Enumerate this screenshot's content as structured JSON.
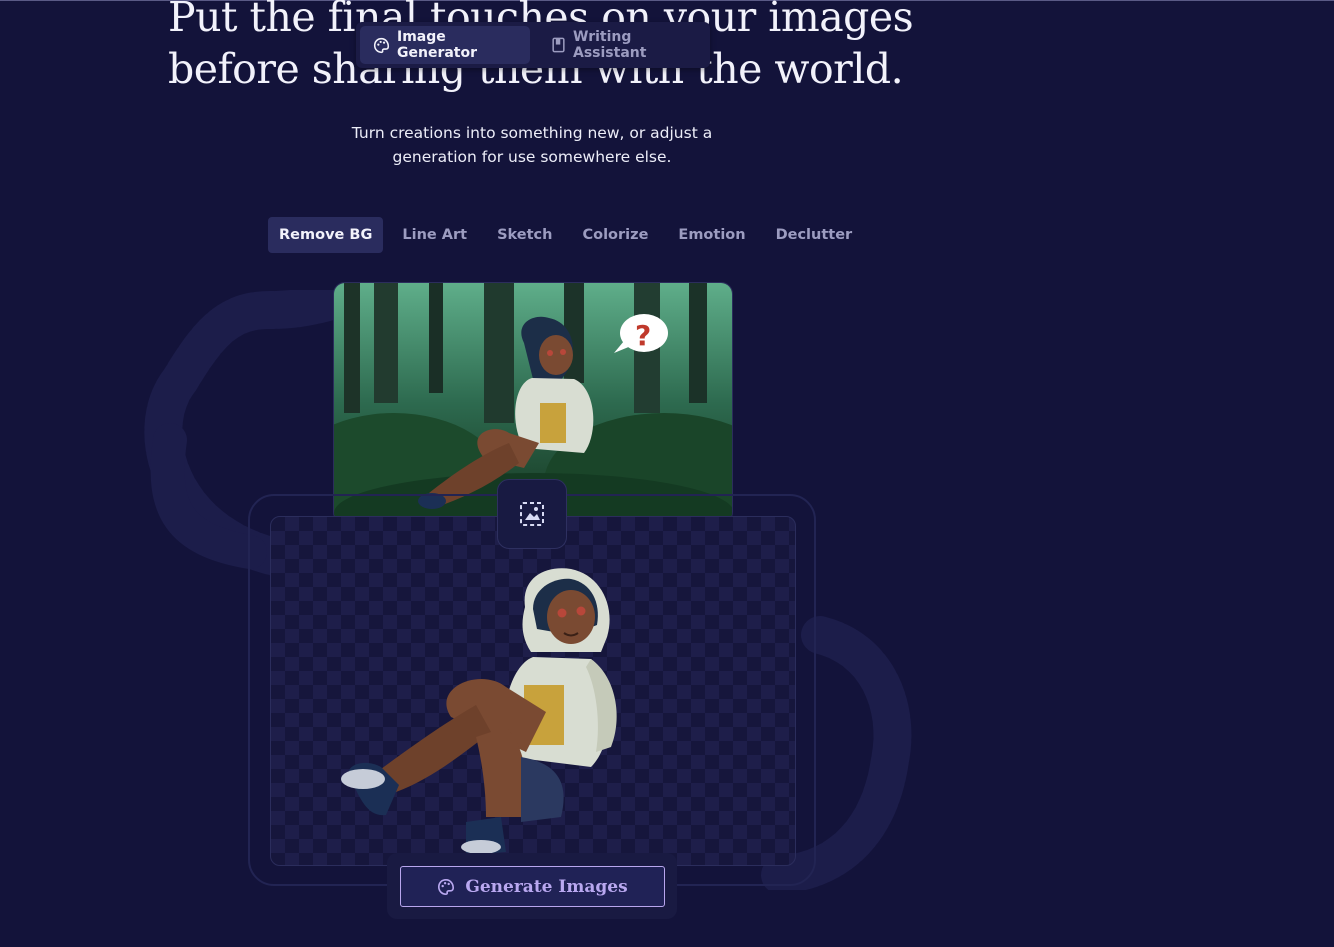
{
  "hero": {
    "headline": "Put the final touches on your images\nbefore sharing them with the world.",
    "subtext": "Turn creations into something new, or adjust a generation for use somewhere else."
  },
  "nav": {
    "tabs": [
      {
        "label": "Image Generator",
        "icon": "palette-icon",
        "active": true
      },
      {
        "label": "Writing Assistant",
        "icon": "book-icon",
        "active": false
      }
    ]
  },
  "tools": {
    "tabs": [
      {
        "label": "Remove BG",
        "active": true
      },
      {
        "label": "Line Art",
        "active": false
      },
      {
        "label": "Sketch",
        "active": false
      },
      {
        "label": "Colorize",
        "active": false
      },
      {
        "label": "Emotion",
        "active": false
      },
      {
        "label": "Declutter",
        "active": false
      }
    ]
  },
  "preview": {
    "before_image": "anime girl in hoodie sitting in green forest with question-mark speech bubble",
    "after_image": "same girl with background removed on transparency checkerboard",
    "speech_bubble_text": "?",
    "transform_icon": "image-select-icon"
  },
  "cta": {
    "label": "Generate Images",
    "icon": "palette-icon"
  },
  "colors": {
    "background": "#13133a",
    "panel": "#1b1b45",
    "active_tab": "#2a2c5e",
    "muted_text": "#9c9cc0",
    "accent": "#b9a8f0"
  }
}
